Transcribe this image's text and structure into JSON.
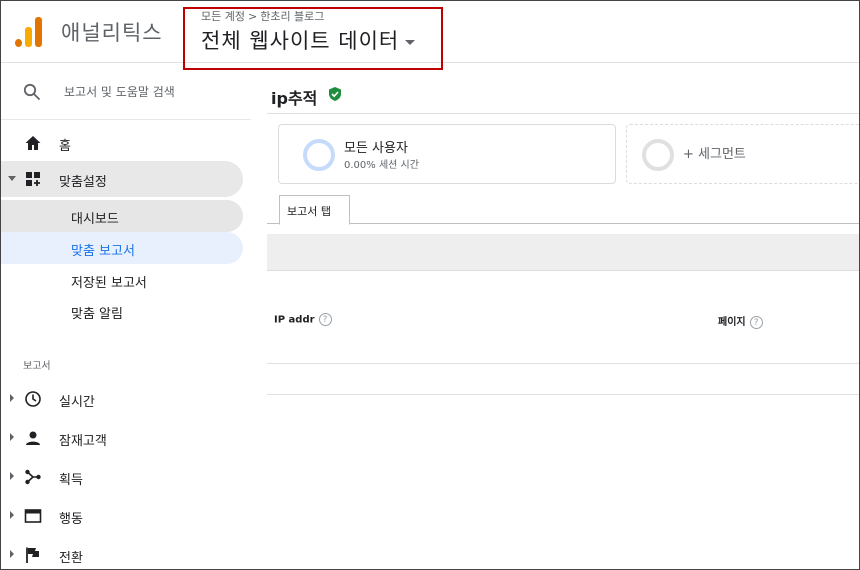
{
  "header": {
    "app_title": "애널리틱스",
    "breadcrumb": [
      "모든 계정",
      "한초리 블로그"
    ],
    "breadcrumb_separator": ">",
    "view_title": "전체 웹사이트 데이터"
  },
  "sidebar": {
    "search_label": "보고서 및 도움말 검색",
    "home_label": "홈",
    "custom_label": "맞춤설정",
    "custom_items": [
      "대시보드",
      "맞춤 보고서",
      "저장된 보고서",
      "맞춤 알림"
    ],
    "reports_section": "보고서",
    "report_items": [
      "실시간",
      "잠재고객",
      "획득",
      "행동",
      "전환"
    ]
  },
  "main": {
    "report_title": "ip추적",
    "segment": {
      "title": "모든 사용자",
      "subtitle": "0.00% 세션 시간",
      "add_label": "+ 세그먼트"
    },
    "tab_label": "보고서 탭",
    "columns": [
      "IP addr",
      "페이지"
    ],
    "help_glyph": "?"
  },
  "colors": {
    "accent": "#1a73e8",
    "highlight_box": "#c00000",
    "verified": "#1e8e3e",
    "logo_dark": "#e37400",
    "logo_light": "#f9ab00"
  }
}
